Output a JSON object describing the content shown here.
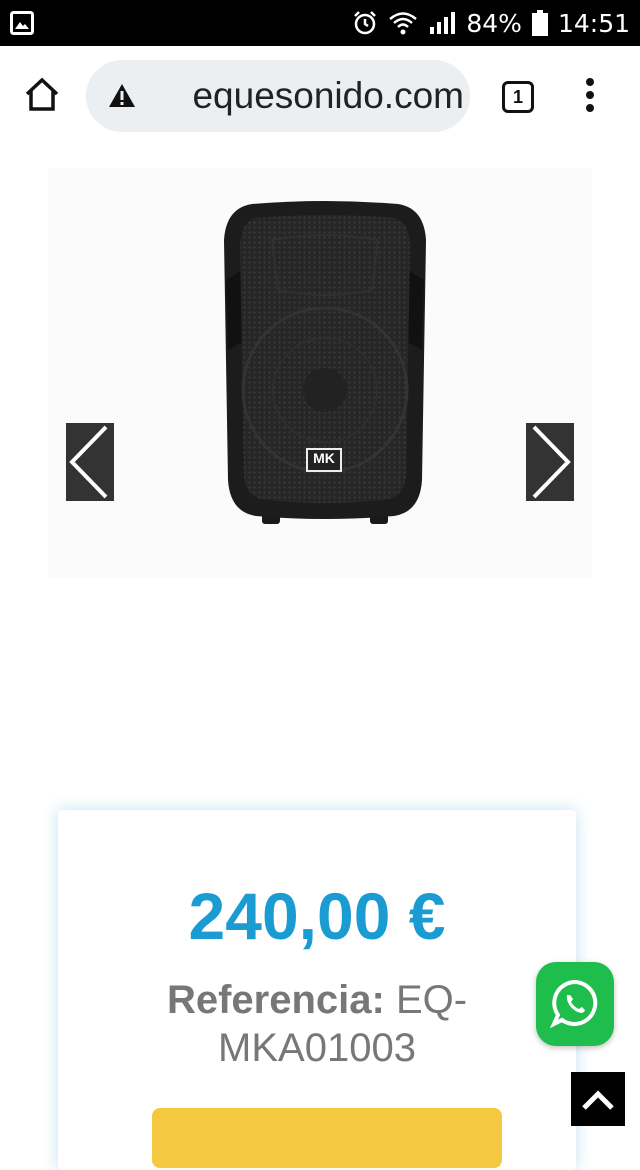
{
  "status_bar": {
    "battery_percent": "84%",
    "time": "14:51",
    "icons": [
      "gallery-icon",
      "alarm-icon",
      "wifi-icon",
      "signal-icon",
      "battery-icon"
    ]
  },
  "browser": {
    "url": "equesonido.com",
    "tab_count": "1",
    "icons": [
      "home-icon",
      "warning-icon",
      "tabs-icon",
      "more-vert-icon"
    ]
  },
  "gallery": {
    "logo_text": "MK",
    "icons": [
      "chevron-left-icon",
      "chevron-right-icon"
    ]
  },
  "product": {
    "price": "240,00 €",
    "reference_label": "Referencia:",
    "reference_value": "EQ-MKA01003"
  },
  "floating": {
    "icons": [
      "whatsapp-icon",
      "chevron-up-icon"
    ]
  },
  "colors": {
    "price": "#1a9bd1",
    "whatsapp": "#1fbd4b",
    "buy_button": "#f5c842",
    "status_bar": "#000000"
  }
}
